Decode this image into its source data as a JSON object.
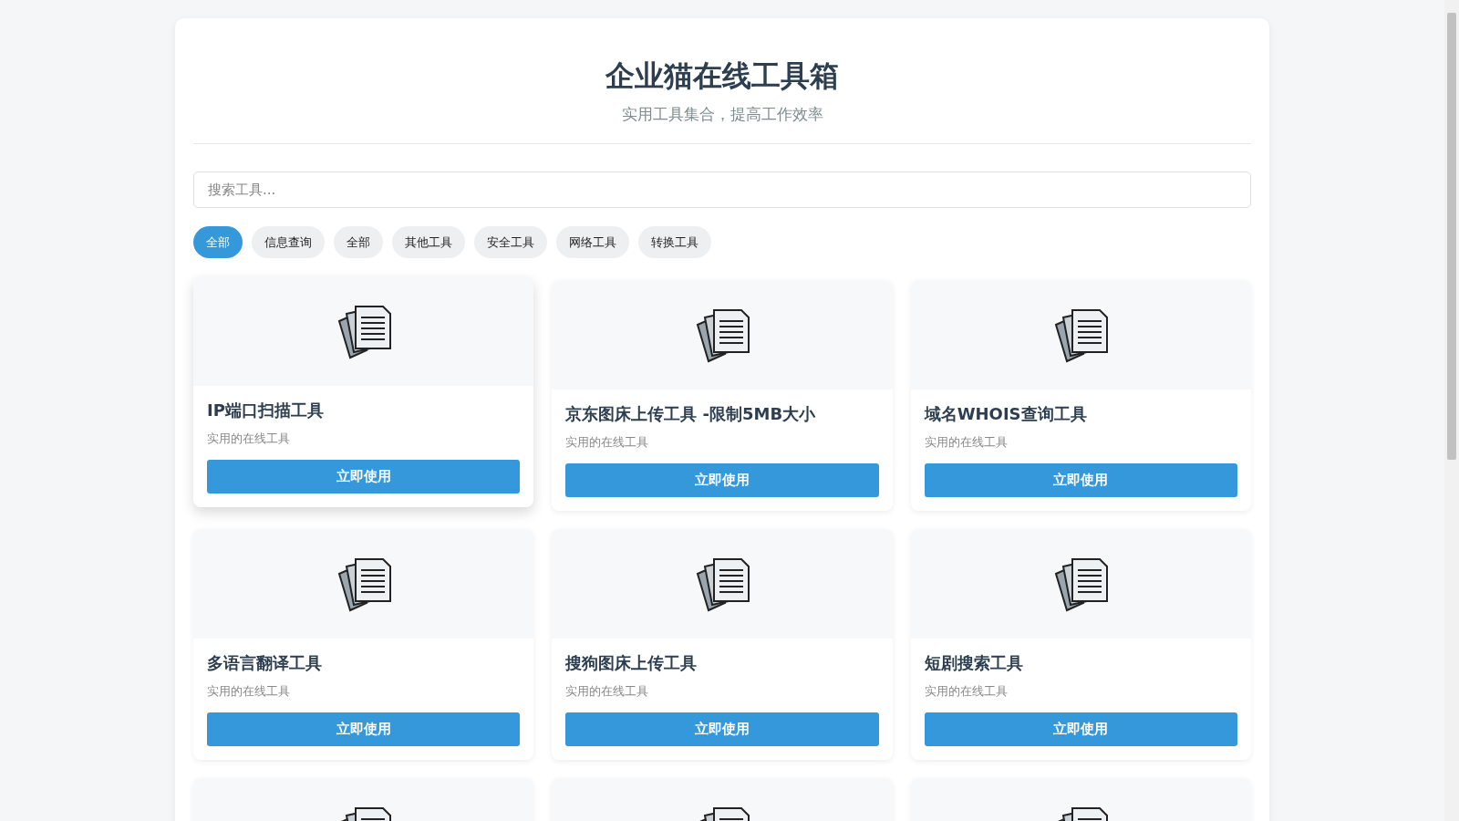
{
  "header": {
    "title": "企业猫在线工具箱",
    "subtitle": "实用工具集合，提高工作效率"
  },
  "search": {
    "placeholder": "搜索工具..."
  },
  "filters": [
    {
      "label": "全部",
      "selected": true
    },
    {
      "label": "信息查询",
      "selected": false
    },
    {
      "label": "全部",
      "selected": false
    },
    {
      "label": "其他工具",
      "selected": false
    },
    {
      "label": "安全工具",
      "selected": false
    },
    {
      "label": "网络工具",
      "selected": false
    },
    {
      "label": "转换工具",
      "selected": false
    }
  ],
  "tools": [
    {
      "kind": "full",
      "title": "IP端口扫描工具",
      "description": "实用的在线工具",
      "button": "立即使用",
      "hovered": true
    },
    {
      "kind": "full",
      "title": "京东图床上传工具 -限制5MB大小",
      "description": "实用的在线工具",
      "button": "立即使用",
      "hovered": false
    },
    {
      "kind": "full",
      "title": "域名WHOIS查询工具",
      "description": "实用的在线工具",
      "button": "立即使用",
      "hovered": false
    },
    {
      "kind": "full",
      "title": "多语言翻译工具",
      "description": "实用的在线工具",
      "button": "立即使用",
      "hovered": false
    },
    {
      "kind": "full",
      "title": "搜狗图床上传工具",
      "description": "实用的在线工具",
      "button": "立即使用",
      "hovered": false
    },
    {
      "kind": "full",
      "title": "短剧搜索工具",
      "description": "实用的在线工具",
      "button": "立即使用",
      "hovered": false
    },
    {
      "kind": "partial",
      "hovered": false
    },
    {
      "kind": "partial",
      "hovered": false
    },
    {
      "kind": "partial",
      "hovered": false
    }
  ]
}
